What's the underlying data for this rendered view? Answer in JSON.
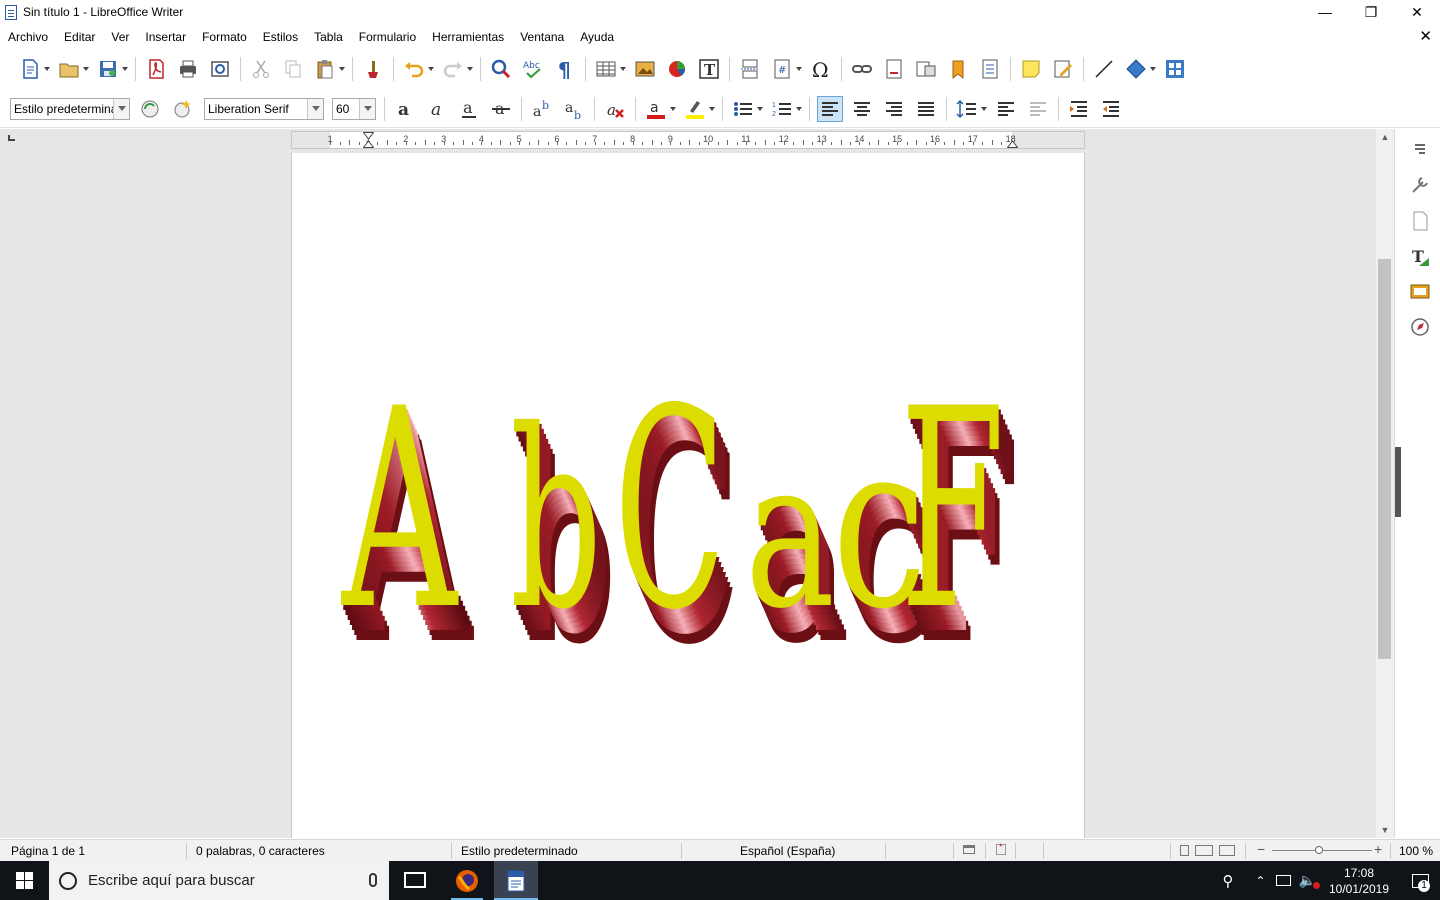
{
  "window": {
    "title": "Sin título 1 - LibreOffice Writer"
  },
  "menu": [
    "Archivo",
    "Editar",
    "Ver",
    "Insertar",
    "Formato",
    "Estilos",
    "Tabla",
    "Formulario",
    "Herramientas",
    "Ventana",
    "Ayuda"
  ],
  "formatting": {
    "paragraph_style": "Estilo predeterminado",
    "font_name": "Liberation Serif",
    "font_size": "60"
  },
  "ruler": {
    "numbers": [
      "1",
      "1",
      "2",
      "3",
      "4",
      "5",
      "6",
      "7",
      "8",
      "9",
      "10",
      "11",
      "12",
      "13",
      "14",
      "15",
      "16",
      "17",
      "18"
    ]
  },
  "document": {
    "fontwork_text": "AbCacF",
    "fontwork_colors": {
      "face": "#dcdc00",
      "side": "#6b0f14",
      "highlight": "#f4a0a8"
    }
  },
  "status": {
    "page": "Página 1 de 1",
    "words": "0 palabras, 0 caracteres",
    "style": "Estilo predeterminado",
    "language": "Español (España)",
    "zoom": "100 %"
  },
  "taskbar": {
    "search_placeholder": "Escribe aquí para buscar",
    "time": "17:08",
    "date": "10/01/2019",
    "notification_count": "1"
  },
  "icons": {
    "toolbar1": [
      "new-document-icon",
      "open-icon",
      "save-icon",
      "export-pdf-icon",
      "print-icon",
      "print-preview-icon",
      "cut-icon",
      "copy-icon",
      "paste-icon",
      "clone-format-icon",
      "undo-icon",
      "redo-icon",
      "find-replace-icon",
      "spelling-icon",
      "formatting-marks-icon",
      "insert-table-icon",
      "insert-image-icon",
      "insert-chart-icon",
      "insert-textbox-icon",
      "page-break-icon",
      "insert-field-icon",
      "special-character-icon",
      "hyperlink-icon",
      "footnote-icon",
      "endnote-icon",
      "bookmark-icon",
      "cross-reference-icon",
      "comment-icon",
      "track-changes-icon",
      "line-icon",
      "basic-shapes-icon",
      "draw-functions-icon"
    ],
    "sidebar": [
      "sidebar-menu-icon",
      "properties-icon",
      "page-icon",
      "styles-icon",
      "gallery-icon",
      "navigator-icon"
    ]
  }
}
